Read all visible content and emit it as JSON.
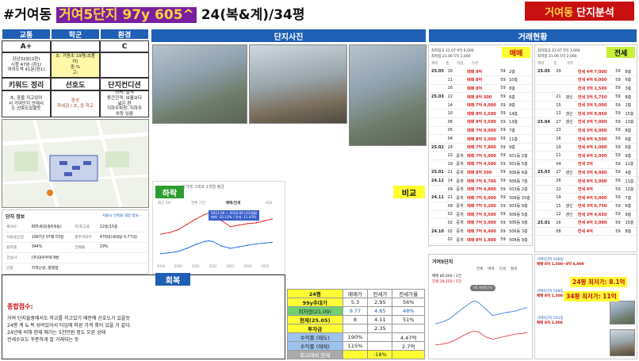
{
  "title": {
    "prefix": "#거여동",
    "highlight": "거여5단지 97y 605^",
    "suffix": "24(복&계)/34평"
  },
  "brand": {
    "region": "거여동",
    "label": "단지분석"
  },
  "grades": {
    "headers": [
      "교통",
      "학군",
      "환경"
    ],
    "values": [
      "A+",
      "",
      "C"
    ],
    "transport_note": "강남32분(2환)\n시청 47분 (환1)\n여의도역 41분(환1)",
    "school_note": "초: 거원초 19명(초품\n아)\n중:%\n고:",
    "keyword_label": "키워드 정리",
    "keyword_value": "선호도",
    "condition_label": "단지컨디션",
    "keyword_note": "초, 중을 끼고있어\n서 거여단지 안에서\n도 선호도있을듯",
    "school_note2": "중상\n학세권 / 초, 중 학교",
    "condition_note": "외벽: 갈색\n동간간격: 보통보다\n넓은 편\n지하주차장: 지하주\n차장 있음"
  },
  "info": {
    "header": "단지 정보",
    "link": "서울시 건축물 대장 정보 ›",
    "rows": [
      [
        "세대수",
        "605세대(총6개동)",
        "저/최고층",
        "12층/15층"
      ],
      [
        "사용승인일",
        "1997년 07월 03일",
        "총주차대수",
        "470대(세대당 0.77대)"
      ],
      [
        "용적률",
        "344%",
        "건폐율",
        "29%"
      ],
      [
        "건설사",
        "(주)대우주택개발",
        "",
        ""
      ],
      [
        "난방",
        "지역난방, 열병합",
        "",
        ""
      ]
    ]
  },
  "summary": {
    "title": "종합점수:",
    "text": "거여 단지들중에서도 학교를 끼고있기 때문에 선호도가 있을듯\n24평 계 & 복 섞여있어서 타입에 따른 가격 확이 있을 거 같다.\n24년에 비해 현재 매가는 5천만원 정도 오른 상태\n전세수요도 꾸준하게 잘 거래되는 듯"
  },
  "sections": {
    "photos": "단지사진",
    "trades": "거래현황"
  },
  "chart": {
    "tab_labels": [
      "최근 3년",
      "전체 기간",
      "매매/전세",
      "비교"
    ],
    "caption": "실거래 그래프 1개월 평균",
    "tooltip1": "2021.09 ~ 2024.06 (33개월)",
    "tooltip2": "매매 -16.12% / 전세 -11.43%",
    "low_tag": "하락",
    "recover_tag": "회복",
    "compare_tag": "비교",
    "x_ticks": [
      "2019",
      "2020",
      "2021",
      "2022",
      "2023",
      "2024",
      "2025"
    ]
  },
  "chart_data": {
    "type": "line",
    "x": [
      2019.0,
      2019.5,
      2020.0,
      2020.5,
      2021.0,
      2021.5,
      2021.75,
      2022.0,
      2022.5,
      2023.0,
      2023.5,
      2024.0,
      2024.5,
      2025.0,
      2025.4
    ],
    "series": [
      {
        "name": "매매",
        "values": [
          5.6,
          5.8,
          6.2,
          6.9,
          7.6,
          8.2,
          8.4,
          8.2,
          7.4,
          6.6,
          6.8,
          7.0,
          7.1,
          7.4,
          7.6
        ]
      },
      {
        "name": "전세",
        "values": [
          3.0,
          3.1,
          3.3,
          3.7,
          4.2,
          4.6,
          4.7,
          4.6,
          4.0,
          3.7,
          3.9,
          4.1,
          4.3,
          4.4,
          4.5
        ]
      }
    ],
    "ylim": [
      2,
      9
    ]
  },
  "compare": {
    "headers": [
      "24평",
      "매매가",
      "전세가",
      "전세가율"
    ],
    "rows": [
      [
        "99y추대가",
        "5.3",
        "2.95",
        "56%"
      ],
      [
        "최저점(21.09)",
        "9.77",
        "4.65",
        "48%"
      ],
      [
        "현재(25.05)",
        "8",
        "4.11",
        "51%"
      ],
      [
        "투자금",
        "",
        "2.35",
        ""
      ],
      [
        "수익률 (매도)",
        "190%",
        "",
        "4.47억"
      ],
      [
        "수익률 (매매)",
        "115%",
        "",
        "2.7억"
      ],
      [
        "회고대비 현재",
        "",
        "-18%",
        ""
      ]
    ]
  },
  "sale": {
    "tag": "매매",
    "summary1": "최저점고 21.07 9억 6,000",
    "summary2": "최저점 21.06 5억 2,000",
    "cols": [
      "계약",
      "층",
      "타입",
      "가격"
    ],
    "rows": [
      [
        "25.05",
        "16",
        "",
        "매매 8억",
        "59",
        "2층"
      ],
      [
        "",
        "11",
        "",
        "매매 8억",
        "59",
        "10층"
      ],
      [
        "",
        "16",
        "",
        "매매 8억",
        "59",
        "8층"
      ],
      [
        "25.03",
        "22",
        "",
        "매매 8억 500",
        "59",
        "6층"
      ],
      [
        "",
        "14",
        "",
        "매매 7억 9,000",
        "59",
        "8층"
      ],
      [
        "",
        "10",
        "",
        "매매 8억 1,500",
        "59",
        "14층"
      ],
      [
        "",
        "06",
        "",
        "매매 8억 3,500",
        "59",
        "13층"
      ],
      [
        "",
        "05",
        "",
        "매매 7억 9,000",
        "59",
        "7층"
      ],
      [
        "",
        "04",
        "",
        "매매 8억 3,000",
        "59",
        "11층"
      ],
      [
        "25.02",
        "24",
        "",
        "매매 7억 7,800",
        "59",
        "9층"
      ],
      [
        "",
        "22",
        "중개",
        "매매 7억 5,000",
        "59",
        "501동 2층"
      ],
      [
        "",
        "19",
        "중개",
        "매매 7억 4,500",
        "59",
        "501동 5층"
      ],
      [
        "25.01",
        "21",
        "중개",
        "매매 8억 500",
        "59",
        "506동 6층"
      ],
      [
        "24.12",
        "14",
        "중개",
        "매매 7억 6,700",
        "59",
        "506동 7층"
      ],
      [
        "",
        "09",
        "중개",
        "매매 7억 4,800",
        "59",
        "503동 2층"
      ],
      [
        "24.11",
        "21",
        "중개",
        "매매 7억 5,000",
        "59",
        "506동 15층"
      ],
      [
        "",
        "09",
        "중개",
        "매매 7억 5,200",
        "59",
        "503동 9층"
      ],
      [
        "",
        "02",
        "중개",
        "매매 7억 5,500",
        "59",
        "506동 5층"
      ],
      [
        "",
        "02",
        "중개",
        "매매 7억 5,000",
        "59",
        "506동 9층"
      ],
      [
        "24.10",
        "02",
        "중개",
        "매매 7억 6,400",
        "59",
        "506동 3층"
      ],
      [
        "",
        "02",
        "중개",
        "매매 8억 1,800",
        "59",
        "508동 9층"
      ],
      [
        "",
        "02",
        "중개",
        "매매 7억 6,400",
        "59",
        "501동 6층"
      ]
    ]
  },
  "rent": {
    "tag": "전세",
    "summary1": "최저점고 21.07 5억 3,000",
    "summary2": "최저점 21.06 5억 2,000",
    "cols": [
      "계약",
      "층",
      "가격"
    ],
    "rows": [
      [
        "25.05",
        "29",
        "",
        "전세 4억 7,000",
        "59",
        "8층"
      ],
      [
        "",
        "",
        "",
        "전세 4억 6,000",
        "59",
        "6층"
      ],
      [
        "",
        "",
        "",
        "전세 3억 1,500",
        "59",
        "3층"
      ],
      [
        "",
        "21",
        "갱신",
        "전세 3억 5,750",
        "59",
        "8층"
      ],
      [
        "",
        "15",
        "",
        "전세 3억 5,000",
        "59",
        "2층"
      ],
      [
        "",
        "13",
        "갱신",
        "전세 3억 8,850",
        "59",
        "15층"
      ],
      [
        "25.04",
        "27",
        "갱신",
        "전세 3억 7,000",
        "59",
        "13층"
      ],
      [
        "",
        "23",
        "",
        "전세 3억 6,000",
        "59",
        "8층"
      ],
      [
        "",
        "16",
        "",
        "전세 4억 4,500",
        "59",
        "6층"
      ],
      [
        "",
        "14",
        "",
        "전세 4억 1,000",
        "59",
        "6층"
      ],
      [
        "",
        "11",
        "",
        "전세 4억 2,000",
        "59",
        "9층"
      ],
      [
        "",
        "04",
        "",
        "전세 3억",
        "59",
        "11층"
      ],
      [
        "25.03",
        "27",
        "갱신",
        "전세 3억 4,000",
        "59",
        "4층"
      ],
      [
        "",
        "26",
        "",
        "전세 4억 2,000",
        "59",
        "11층"
      ],
      [
        "",
        "22",
        "",
        "전세 4억",
        "59",
        "12층"
      ],
      [
        "",
        "19",
        "",
        "전세 4억 5,000",
        "59",
        "7층"
      ],
      [
        "",
        "15",
        "갱신",
        "전세 3억 6,750",
        "59",
        "6층"
      ],
      [
        "",
        "12",
        "갱신",
        "전세 3억 4,650",
        "59",
        "9층"
      ],
      [
        "25.01",
        "16",
        "",
        "전세 4억 3,000",
        "59",
        "15층"
      ],
      [
        "",
        "08",
        "",
        "전세 4억",
        "59",
        "8층"
      ]
    ]
  },
  "mini_chart": {
    "title": "거여5단지",
    "sub": "매매 80,000 / 2건",
    "sub2": "전세 39,250 / 5건",
    "badge": "VS 거여5단지",
    "tabs": [
      "전체",
      "매매",
      "전세",
      "월세"
    ]
  },
  "listings": {
    "top_label": "24평 최저가: 8.1억",
    "bottom_label": "34평 최저가: 11억",
    "items": [
      {
        "name": "거여5단지 506동",
        "price": "매매 8억 1,500~8억 6,000"
      },
      {
        "name": "거여5단지 508동",
        "price": "매매 8억 1,500"
      },
      {
        "name": "거여5단지 501동",
        "price": "매매 8억 2,000"
      }
    ]
  }
}
